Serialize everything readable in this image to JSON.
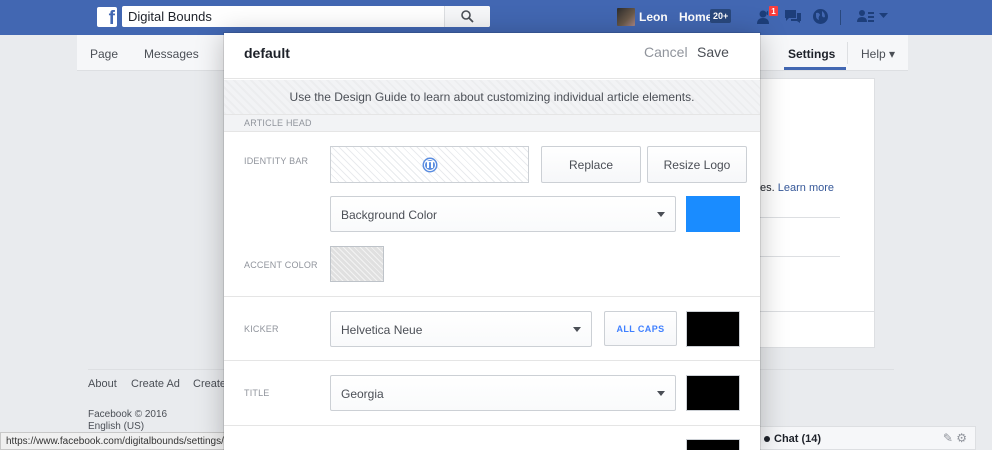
{
  "topbar": {
    "search_value": "Digital Bounds",
    "user_name": "Leon",
    "home_label": "Home",
    "home_count": "20+",
    "friend_requests_badge": "1",
    "icons": [
      "facebook-logo-icon",
      "search-icon",
      "friend-requests-icon",
      "messages-icon",
      "notifications-globe-icon",
      "account-menu-icon",
      "dropdown-chevron-icon"
    ]
  },
  "pagenav": {
    "items": [
      "Page",
      "Messages"
    ],
    "settings_label": "Settings",
    "help_label": "Help ▾"
  },
  "background": {
    "learn_more_prefix": "es.",
    "learn_more_link": "Learn more",
    "footer_links": [
      "About",
      "Create Ad",
      "Create"
    ],
    "copyright": "Facebook © 2016",
    "language": "English (US)",
    "status_url": "https://www.facebook.com/digitalbounds/settings/?tab=instant_articles#",
    "chat_label": "Chat (14)"
  },
  "modal": {
    "title": "default",
    "cancel_label": "Cancel",
    "save_label": "Save",
    "guide_text": "Use the Design Guide to learn about customizing individual article elements.",
    "section_heading": "ARTICLE HEAD",
    "identity_bar": {
      "label": "IDENTITY BAR",
      "replace_label": "Replace",
      "resize_label": "Resize Logo",
      "background_select": "Background Color",
      "background_color": "#1a8cff"
    },
    "accent_color": {
      "label": "ACCENT COLOR",
      "color": "#dadada"
    },
    "kicker": {
      "label": "KICKER",
      "font": "Helvetica Neue",
      "allcaps_label": "ALL CAPS",
      "color": "#000000"
    },
    "title_row": {
      "label": "TITLE",
      "font": "Georgia",
      "color": "#000000"
    }
  },
  "colors": {
    "facebook_blue": "#4267b2",
    "link_blue": "#365899",
    "allcaps_blue": "#4080ff"
  }
}
